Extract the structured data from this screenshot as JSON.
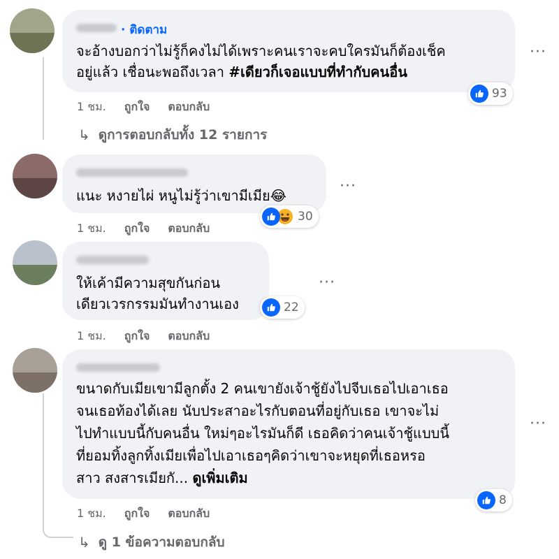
{
  "colors": {
    "accent": "#0866ff",
    "bubble": "#f0f2f5",
    "meta": "#65676b"
  },
  "comments": [
    {
      "follow_label": "· ติดตาม",
      "lines": [
        "จะอ้างบอกว่าไม่รู้ก็คงไม่ได้เพราะคนเราจะคบใครมันก็ต้องเช็ค",
        "อยู่แล้ว เชื่อนะพอถึงเวลา "
      ],
      "hashtag": "#เดียวก็เจอแบบที่ทำกับคนอื่น",
      "reaction_count": "93",
      "reaction_icons": [
        "like-icon"
      ],
      "time": "1 ชม.",
      "like_label": "ถูกใจ",
      "reply_label": "ตอบกลับ",
      "replies_link": "ดูการตอบกลับทั้ง 12 รายการ"
    },
    {
      "lines": [
        "แนะ หงายไผ่ หนูไม่รู้ว่าเขามีเมีย😂"
      ],
      "reaction_count": "30",
      "reaction_icons": [
        "like-icon",
        "haha-icon"
      ],
      "time": "1 ชม.",
      "like_label": "ถูกใจ",
      "reply_label": "ตอบกลับ"
    },
    {
      "lines": [
        "ให้เค้ามีความสุขกันก่อน",
        "เดียวเวรกรรมมันทำงานเอง"
      ],
      "reaction_count": "22",
      "reaction_icons": [
        "like-icon"
      ],
      "time": "1 ชม.",
      "like_label": "ถูกใจ",
      "reply_label": "ตอบกลับ"
    },
    {
      "lines": [
        "ขนาดกับเมียเขามีลูกตั้ง 2 คนเขายังเจ้าชู้ยังไปจีบเธอไปเอาเธอ",
        "จนเธอท้องได้เลย นับประสาอะไรกับตอนที่อยู่กับเธอ เขาจะไม่",
        "ไปทำแบบนี้กับคนอื่น ใหม่ๆอะไรมันก็ดี เธอคิดว่าคนเจ้าชู้แบบนี้",
        "ที่ยอมทิ้งลูกทิ้งเมียเพื่อไปเอาเธอๆคิดว่าเขาจะหยุดที่เธอหรอ",
        "สาว สงสารเมียกั... "
      ],
      "see_more": "ดูเพิ่มเติม",
      "reaction_count": "8",
      "reaction_icons": [
        "like-icon"
      ],
      "time": "1 ชม.",
      "like_label": "ถูกใจ",
      "reply_label": "ตอบกลับ",
      "replies_link": "ดู 1 ข้อความตอบกลับ"
    }
  ],
  "more_icon": "more-options-icon"
}
